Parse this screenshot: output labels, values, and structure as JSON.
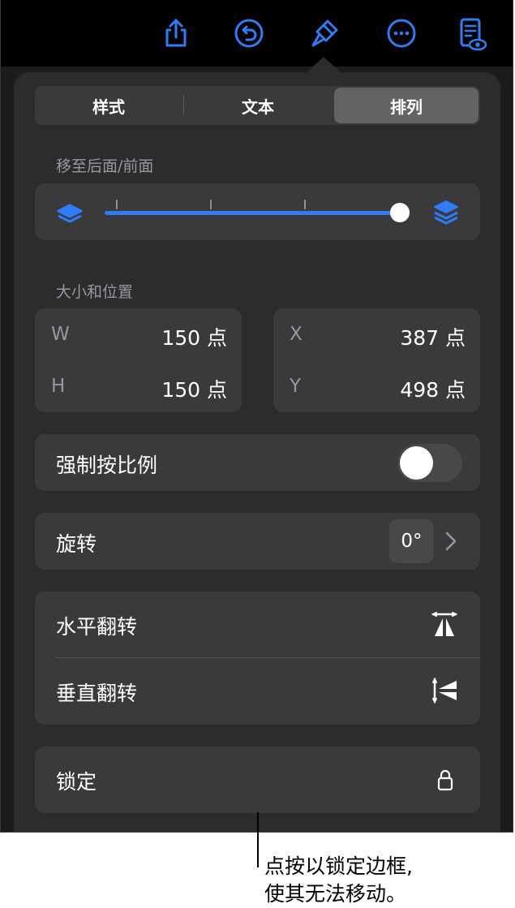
{
  "toolbar": {
    "icons": [
      "share-icon",
      "undo-icon",
      "format-brush-icon",
      "more-icon",
      "reader-view-icon"
    ],
    "accent": "#2f7cf6"
  },
  "tabs": [
    {
      "label": "样式",
      "active": false
    },
    {
      "label": "文本",
      "active": false
    },
    {
      "label": "排列",
      "active": true
    }
  ],
  "layer": {
    "section_label": "移至后面/前面",
    "slider_value": 1.0
  },
  "size_position": {
    "section_label": "大小和位置",
    "w_key": "W",
    "w_val": "150 点",
    "h_key": "H",
    "h_val": "150 点",
    "x_key": "X",
    "x_val": "387 点",
    "y_key": "Y",
    "y_val": "498 点"
  },
  "constrain": {
    "label": "强制按比例",
    "on": false
  },
  "rotate": {
    "label": "旋转",
    "value": "0°"
  },
  "flip": {
    "horizontal_label": "水平翻转",
    "vertical_label": "垂直翻转"
  },
  "lock": {
    "label": "锁定"
  },
  "callout": {
    "line1": "点按以锁定边框,",
    "line2": "使其无法移动。"
  },
  "colors": {
    "accent": "#2f7cf6",
    "panel": "#2c2c2e",
    "card": "#3a3a3c",
    "toggle_off": "#48484a"
  }
}
